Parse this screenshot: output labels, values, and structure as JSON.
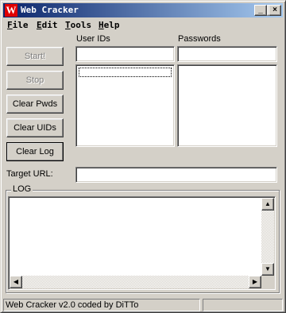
{
  "window": {
    "title": "Web Cracker",
    "app_icon_letter": "W",
    "minimize_glyph": "_",
    "maximize_glyph": "□",
    "close_glyph": "×"
  },
  "menu": [
    {
      "label": "File",
      "mnemonic": "F",
      "rest": "ile"
    },
    {
      "label": "Edit",
      "mnemonic": "E",
      "rest": "dit"
    },
    {
      "label": "Tools",
      "mnemonic": "T",
      "rest": "ools"
    },
    {
      "label": "Help",
      "mnemonic": "H",
      "rest": "elp"
    }
  ],
  "buttons": {
    "start": "Start!",
    "stop": "Stop",
    "clear_pwds": "Clear Pwds",
    "clear_uids": "Clear UIDs",
    "clear_log": "Clear Log"
  },
  "labels": {
    "user_ids": "User IDs",
    "passwords": "Passwords",
    "target_url": "Target URL:",
    "log": "LOG"
  },
  "inputs": {
    "user_id_value": "",
    "password_value": "",
    "target_url_value": ""
  },
  "status": {
    "text": "Web Cracker v2.0 coded by DiTTo",
    "pane2": ""
  },
  "icons": {
    "scroll_up": "▲",
    "scroll_down": "▼",
    "scroll_left": "◀",
    "scroll_right": "▶"
  }
}
